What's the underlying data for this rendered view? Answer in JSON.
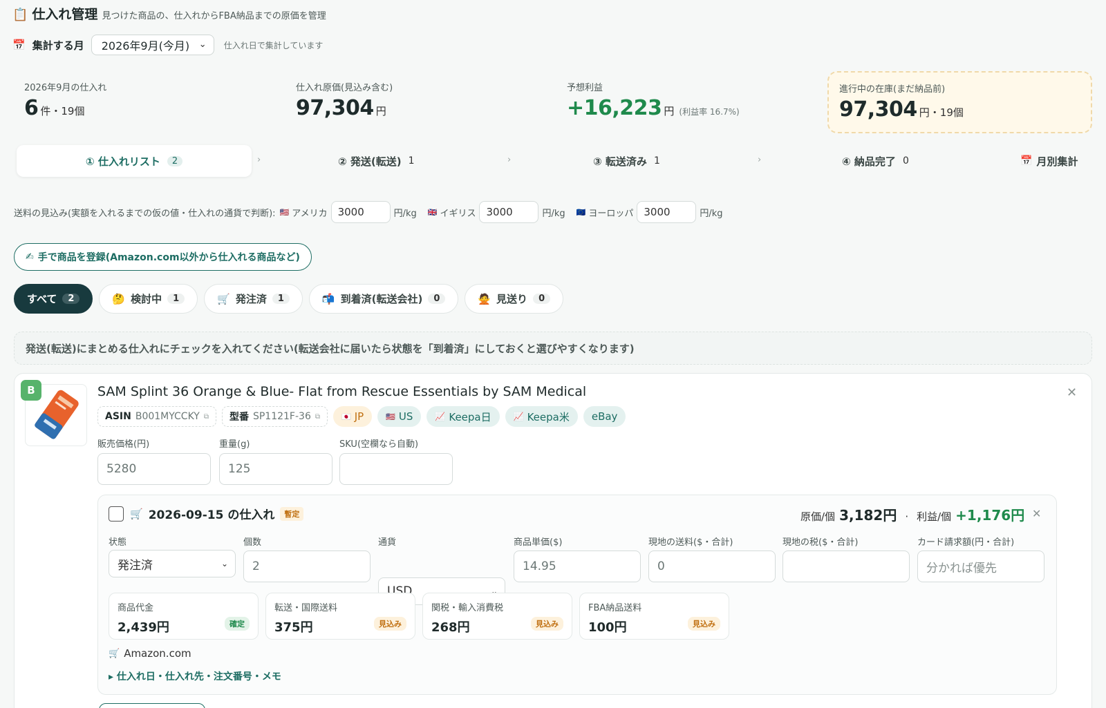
{
  "header": {
    "icon": "clipboard-icon",
    "title": "仕入れ管理",
    "subtitle": "見つけた商品の、仕入れからFBA納品までの原価を管理"
  },
  "month": {
    "label": "集計する月",
    "selected": "2026年9月(今月)",
    "hint": "仕入れ日で集計しています"
  },
  "stats": {
    "purchases": {
      "label": "2026年9月の仕入れ",
      "count": "6",
      "count_unit": "件・19個"
    },
    "cost": {
      "label": "仕入れ原価(見込み含む)",
      "value": "97,304",
      "unit": "円"
    },
    "profit": {
      "label": "予想利益",
      "value": "+16,223",
      "unit": "円",
      "rate": "(利益率 16.7%)"
    },
    "inventory": {
      "label": "進行中の在庫(まだ納品前)",
      "value": "97,304",
      "unit": "円・19個"
    }
  },
  "steps": [
    {
      "label": "① 仕入れリスト",
      "count": "2"
    },
    {
      "label": "② 発送(転送)",
      "count": "1"
    },
    {
      "label": "③ 転送済み",
      "count": "1"
    },
    {
      "label": "④ 納品完了",
      "count": "0"
    },
    {
      "label": "月別集計",
      "count": ""
    }
  ],
  "shipping": {
    "intro": "送料の見込み(実額を入れるまでの仮の値・仕入れの通貨で判断):",
    "per_unit": "円/kg",
    "regions": [
      {
        "flag": "🇺🇸",
        "name": "アメリカ",
        "value": "3000"
      },
      {
        "flag": "🇬🇧",
        "name": "イギリス",
        "value": "3000"
      },
      {
        "flag": "🇪🇺",
        "name": "ヨーロッパ",
        "value": "3000"
      }
    ]
  },
  "manual_register": {
    "icon": "✍",
    "label": "手で商品を登録(Amazon.com以外から仕入れる商品など)"
  },
  "filters": [
    {
      "icon": "",
      "label": "すべて",
      "count": "2"
    },
    {
      "icon": "🤔",
      "label": "検討中",
      "count": "1"
    },
    {
      "icon": "🛒",
      "label": "発注済",
      "count": "1"
    },
    {
      "icon": "📬",
      "label": "到着済(転送会社)",
      "count": "0"
    },
    {
      "icon": "🙅",
      "label": "見送り",
      "count": "0"
    }
  ],
  "notice": "発送(転送)にまとめる仕入れにチェックを入れてください(転送会社に届いたら状態を「到着済」にしておくと選びやすくなります)",
  "product": {
    "grade": "B",
    "title": "SAM Splint 36 Orange & Blue- Flat from Rescue Essentials by SAM Medical",
    "asin_label": "ASIN",
    "asin": "B001MYCCKY",
    "model_label": "型番",
    "model": "SP1121F-36",
    "links": [
      "JP",
      "US",
      "Keepa日",
      "Keepa米",
      "eBay"
    ],
    "fields": {
      "price_label": "販売価格(円)",
      "price": "5280",
      "weight_label": "重量(g)",
      "weight": "125",
      "sku_label": "SKU(空欄なら自動)",
      "sku": ""
    }
  },
  "purchase": {
    "title": "2026-09-15 の仕入れ",
    "provisional": "暫定",
    "unit_cost_label": "原価/個",
    "unit_cost": "3,182円",
    "unit_profit_label": "利益/個",
    "unit_profit": "+1,176円",
    "fields": [
      {
        "label": "状態",
        "value": "発注済",
        "type": "select"
      },
      {
        "label": "個数",
        "value": "2",
        "type": "input"
      },
      {
        "label": "通貨",
        "value": "USD",
        "type": "select"
      },
      {
        "label": "商品単価($)",
        "value": "14.95",
        "type": "input"
      },
      {
        "label": "現地の送料($・合計)",
        "value": "0",
        "type": "input"
      },
      {
        "label": "現地の税($・合計)",
        "value": "",
        "type": "input"
      },
      {
        "label": "カード請求額(円・合計)",
        "value": "分かれば優先",
        "type": "placeholder"
      }
    ],
    "costs": [
      {
        "label": "商品代金",
        "value": "2,439円",
        "badge": "確定",
        "kind": "ok"
      },
      {
        "label": "転送・国際送料",
        "value": "375円",
        "badge": "見込み",
        "kind": "est"
      },
      {
        "label": "関税・輸入消費税",
        "value": "268円",
        "badge": "見込み",
        "kind": "est"
      },
      {
        "label": "FBA納品送料",
        "value": "100円",
        "badge": "見込み",
        "kind": "est"
      }
    ],
    "source": "Amazon.com",
    "details_toggle": "仕入れ日・仕入れ先・注文番号・メモ"
  }
}
